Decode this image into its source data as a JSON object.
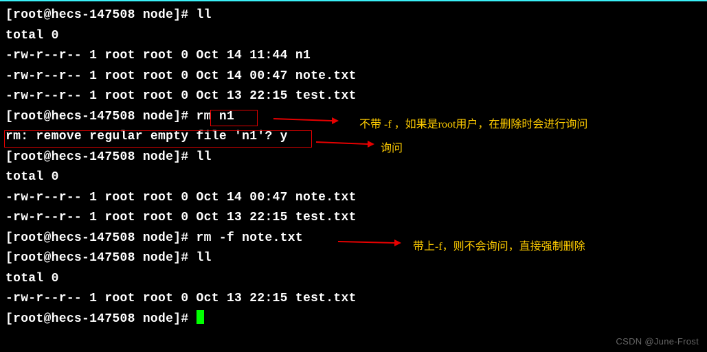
{
  "prompt1": "[root@hecs-147508 node]# ",
  "prompt2": "[root@hecs-147508 node]# ",
  "prompt3": "[root@hecs-147508 node]# ",
  "prompt4": "[root@hecs-147508 node]# ",
  "prompt5": "[root@hecs-147508 node]# ",
  "prompt6": "[root@hecs-147508 node]# ",
  "cmd_ll1": "ll",
  "cmd_rm1": "rm n1",
  "cmd_ll2": "ll",
  "cmd_rm2": "rm -f note.txt",
  "cmd_ll3": "ll",
  "out_total1": "total 0",
  "out_file1": "-rw-r--r-- 1 root root 0 Oct 14 11:44 n1",
  "out_file2": "-rw-r--r-- 1 root root 0 Oct 14 00:47 note.txt",
  "out_file3": "-rw-r--r-- 1 root root 0 Oct 13 22:15 test.txt",
  "out_confirm": "rm: remove regular empty file 'n1'? y",
  "out_total2": "total 0",
  "out_file4": "-rw-r--r-- 1 root root 0 Oct 14 00:47 note.txt",
  "out_file5": "-rw-r--r-- 1 root root 0 Oct 13 22:15 test.txt",
  "out_total3": "total 0",
  "out_file6": "-rw-r--r-- 1 root root 0 Oct 13 22:15 test.txt",
  "annot1": "不带 -f ，如果是root用户，在删除时会进行询问",
  "annot2": "询问",
  "annot3": "带上-f，则不会询问，直接强制删除",
  "watermark": "CSDN @June-Frost"
}
